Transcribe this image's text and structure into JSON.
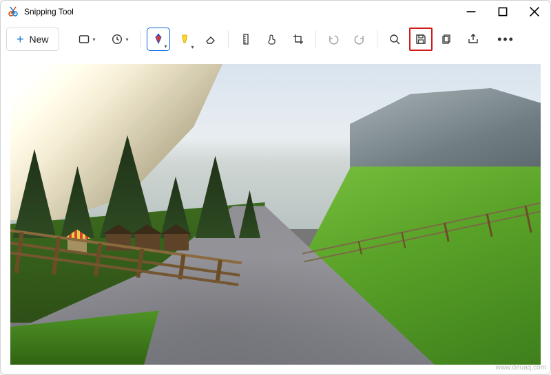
{
  "window": {
    "title": "Snipping Tool"
  },
  "toolbar": {
    "new_label": "New"
  },
  "icons": {
    "minimize": "—",
    "maximize": "▢",
    "close": "✕"
  },
  "watermark": "www.deuaq.com"
}
